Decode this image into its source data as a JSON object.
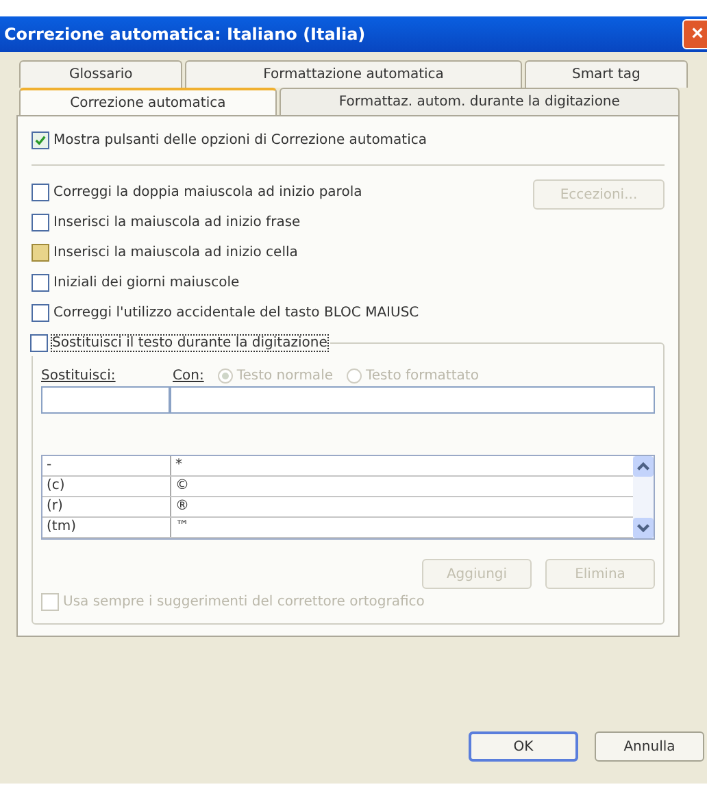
{
  "window": {
    "title": "Correzione automatica: Italiano (Italia)",
    "close": "×"
  },
  "tabs_back": [
    {
      "label": "Glossario",
      "selected": false
    },
    {
      "label": "Formattazione automatica",
      "selected": false
    },
    {
      "label": "Smart tag",
      "selected": false
    }
  ],
  "tabs_front": [
    {
      "label": "Correzione automatica",
      "selected": true
    },
    {
      "label": "Formattaz. autom. durante la digitazione",
      "selected": false
    }
  ],
  "show_buttons": {
    "label": "Mostra pulsanti delle opzioni di Correzione automatica",
    "checked": true
  },
  "options": [
    {
      "label": "Correggi la doppia maiuscola ad inizio parola",
      "checked": false,
      "highlighted": false
    },
    {
      "label": "Inserisci la maiuscola ad inizio frase",
      "checked": false,
      "highlighted": false
    },
    {
      "label": "Inserisci la maiuscola ad inizio cella",
      "checked": false,
      "highlighted": true
    },
    {
      "label": "Iniziali dei giorni maiuscole",
      "checked": false,
      "highlighted": false
    },
    {
      "label": "Correggi l'utilizzo accidentale del tasto BLOC MAIUSC",
      "checked": false,
      "highlighted": false
    }
  ],
  "exceptions_button": {
    "label": "Eccezioni...",
    "disabled": true
  },
  "replace": {
    "label": "Sostituisci il testo durante la digitazione",
    "checked": false,
    "focused": true
  },
  "replace_label": "Sostituisci:",
  "with_label": "Con:",
  "format_radios": [
    {
      "label": "Testo normale",
      "selected": true,
      "disabled": true
    },
    {
      "label": "Testo formattato",
      "selected": false,
      "disabled": true
    }
  ],
  "list": [
    {
      "from": "-",
      "to": "*"
    },
    {
      "from": "(c)",
      "to": "©"
    },
    {
      "from": "(r)",
      "to": "®"
    },
    {
      "from": "(tm)",
      "to": "™"
    }
  ],
  "list_buttons": [
    {
      "label": "Aggiungi",
      "disabled": true
    },
    {
      "label": "Elimina",
      "disabled": true
    }
  ],
  "suggestions": {
    "label": "Usa sempre i suggerimenti del correttore ortografico",
    "checked": false,
    "disabled": true
  },
  "buttons": [
    {
      "label": "OK",
      "default": true
    },
    {
      "label": "Annulla",
      "default": false
    }
  ]
}
